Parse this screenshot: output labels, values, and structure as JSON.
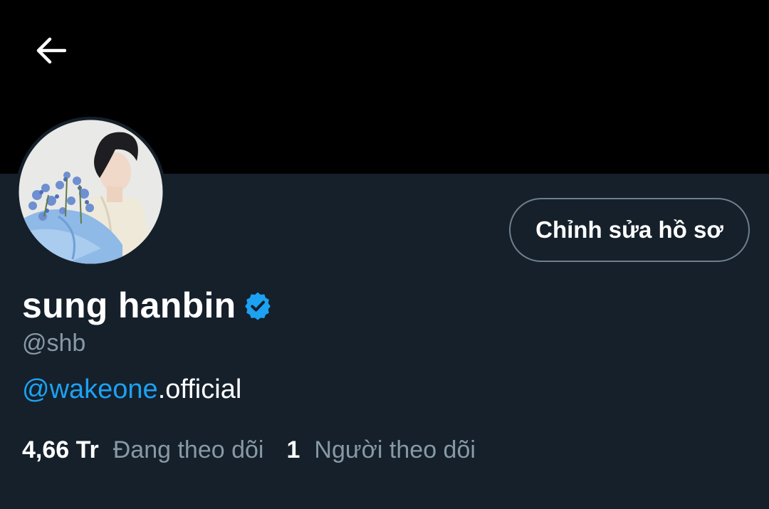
{
  "header": {
    "back_icon": "arrow-left-icon"
  },
  "profile": {
    "display_name": "sung hanbin",
    "verified": true,
    "verified_icon": "verified-badge-icon",
    "handle": "@shb",
    "bio": {
      "mention": "@wakeone",
      "rest": ".official"
    },
    "edit_button_label": "Chỉnh sửa hồ sơ",
    "stats": {
      "following_count": "4,66 Tr",
      "following_label": "Đang theo dõi",
      "followers_count": "1",
      "followers_label": "Người theo dõi"
    }
  },
  "colors": {
    "background": "#15202b",
    "banner": "#000000",
    "accent": "#1da1f2",
    "secondary_text": "#8899a6",
    "primary_text": "#ffffff"
  }
}
